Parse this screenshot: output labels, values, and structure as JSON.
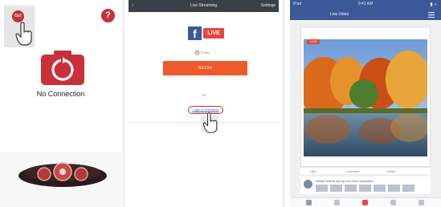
{
  "panel1": {
    "corner_button_label": "Go!",
    "help_label": "?",
    "status_text": "No Connection",
    "colors": {
      "accent": "#c9303a"
    }
  },
  "panel2": {
    "header": {
      "back": "‹",
      "title": "Live Streaming",
      "right": "Settings"
    },
    "fb_letter": "f",
    "live_badge": "LIVE",
    "radio_label": "Public",
    "go_live_button": "Go Live",
    "or_label": "OR",
    "link_text": "Login to Facebook",
    "colors": {
      "button": "#ee5a2c",
      "facebook": "#3b5998",
      "live": "#e8453c"
    }
  },
  "panel3": {
    "status_bar": {
      "left": "iPad",
      "center": "9:41 AM",
      "icons": "▮ ⌁"
    },
    "subbar_title": "Live Video",
    "live_badge": "LIVE",
    "actions": [
      "Like",
      "Comment",
      "Share"
    ],
    "comment_text": "Watch videos and go live from anywhere",
    "colors": {
      "facebook": "#3b5998"
    }
  }
}
